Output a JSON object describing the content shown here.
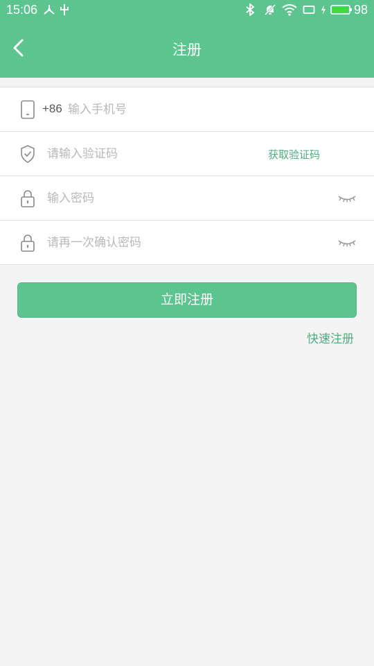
{
  "status_bar": {
    "time": "15:06",
    "battery_level": "98",
    "icons": [
      "usb-debug-icon",
      "usb-icon",
      "bluetooth-icon",
      "mute-icon",
      "wifi-icon",
      "screen-icon",
      "charging-icon",
      "battery-icon"
    ]
  },
  "header": {
    "title": "注册",
    "background_color": "#5bc48f"
  },
  "form": {
    "phone": {
      "country_code": "+86",
      "placeholder": "输入手机号",
      "value": ""
    },
    "code": {
      "placeholder": "请输入验证码",
      "value": "",
      "get_code_label": "获取验证码"
    },
    "password": {
      "placeholder": "输入密码",
      "value": ""
    },
    "confirm_password": {
      "placeholder": "请再一次确认密码",
      "value": ""
    }
  },
  "actions": {
    "register_label": "立即注册",
    "quick_register_label": "快速注册"
  },
  "colors": {
    "accent": "#5bc48f",
    "link": "#4caf7e",
    "background": "#f4f4f4"
  }
}
